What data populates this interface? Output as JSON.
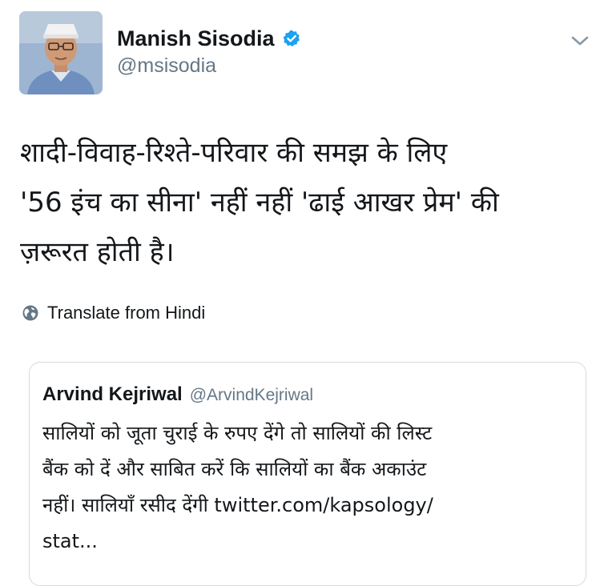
{
  "tweet": {
    "author": {
      "name": "Manish Sisodia",
      "handle": "@msisodia",
      "verified": true
    },
    "text_lines": [
      "शादी-विवाह-रिश्ते-परिवार की समझ के लिए",
      "'56 इंच का सीना' नहीं नहीं 'ढाई आखर प्रेम' की",
      "ज़रूरत होती है।"
    ],
    "translate_label": "Translate from Hindi"
  },
  "quoted_tweet": {
    "name": "Arvind Kejriwal",
    "handle": "@ArvindKejriwal",
    "text_lines": [
      "सालियों को जूता चुराई के रुपए देंगे तो सालियों की लिस्ट",
      "बैंक को दें और साबित करें कि सालियों का बैंक अकाउंट",
      "नहीं। सालियाँ रसीद देंगी twitter.com/kapsology/",
      "stat..."
    ]
  },
  "colors": {
    "text_primary": "#14171a",
    "text_secondary": "#657786",
    "verified_blue": "#1da1f2",
    "card_border": "#d4dbe1"
  },
  "icons": {
    "verified": "verified-badge-icon",
    "caret": "chevron-down-icon",
    "globe": "globe-icon"
  }
}
